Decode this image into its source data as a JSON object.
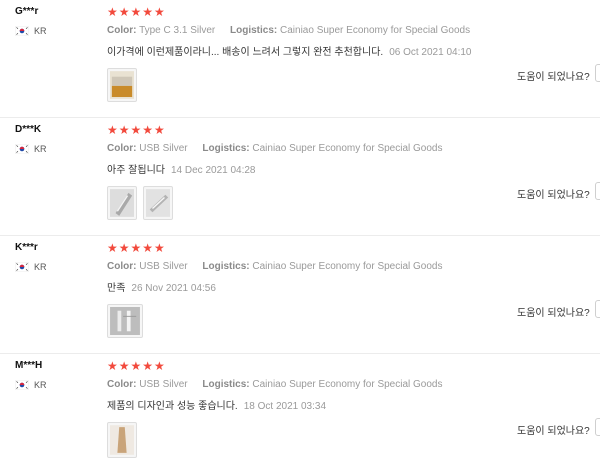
{
  "helpful_label": "도움이 되었나요?",
  "colors": {
    "star": "#f24a3d",
    "meta": "#9a9a9a"
  },
  "reviews": [
    {
      "user": "G***r",
      "country": "KR",
      "stars": "★★★★★",
      "color_label": "Color:",
      "color_value": "Type C 3.1 Silver",
      "logistics_label": "Logistics:",
      "logistics_value": "Cainiao Super Economy for Special Goods",
      "text": "이가격에 이런제품이라니... 배송이 느려서 그렇지 완전 추천합니다.",
      "date": "06 Oct 2021 04:10",
      "image_count": 1
    },
    {
      "user": "D***K",
      "country": "KR",
      "stars": "★★★★★",
      "color_label": "Color:",
      "color_value": "USB Silver",
      "logistics_label": "Logistics:",
      "logistics_value": "Cainiao Super Economy for Special Goods",
      "text": "아주 잘됩니다",
      "date": "14 Dec 2021 04:28",
      "image_count": 2
    },
    {
      "user": "K***r",
      "country": "KR",
      "stars": "★★★★★",
      "color_label": "Color:",
      "color_value": "USB Silver",
      "logistics_label": "Logistics:",
      "logistics_value": "Cainiao Super Economy for Special Goods",
      "text": "만족",
      "date": "26 Nov 2021 04:56",
      "image_count": 1
    },
    {
      "user": "M***H",
      "country": "KR",
      "stars": "★★★★★",
      "color_label": "Color:",
      "color_value": "USB Silver",
      "logistics_label": "Logistics:",
      "logistics_value": "Cainiao Super Economy for Special Goods",
      "text": "제품의 디자인과 성능 좋습니다.",
      "date": "18 Oct 2021 03:34",
      "image_count": 1
    }
  ]
}
